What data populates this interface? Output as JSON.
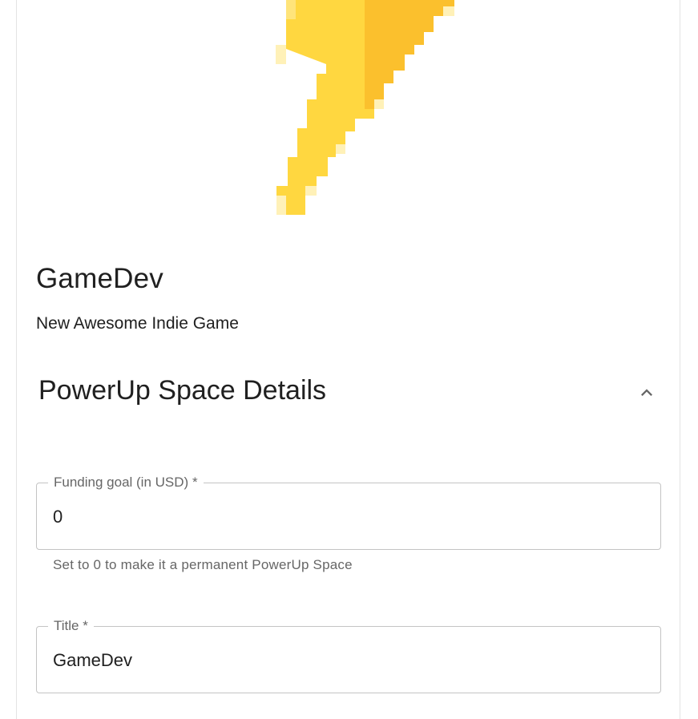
{
  "space": {
    "title": "GameDev",
    "subtitle": "New Awesome Indie Game"
  },
  "details": {
    "heading": "PowerUp Space Details",
    "toggle_icon": "chevron-up-icon"
  },
  "funding_goal": {
    "label": "Funding goal (in USD)",
    "required_marker": "*",
    "value": "0",
    "helper_text": "Set to 0 to make it a permanent PowerUp Space"
  },
  "title_field": {
    "label": "Title",
    "required_marker": "*",
    "value": "GameDev"
  },
  "colors": {
    "bolt_light": "#ffd740",
    "bolt_dark": "#fbc02d",
    "bolt_pale": "#fff1b8",
    "border": "#c4c4c4",
    "muted_text": "#666666",
    "text": "#202020"
  }
}
